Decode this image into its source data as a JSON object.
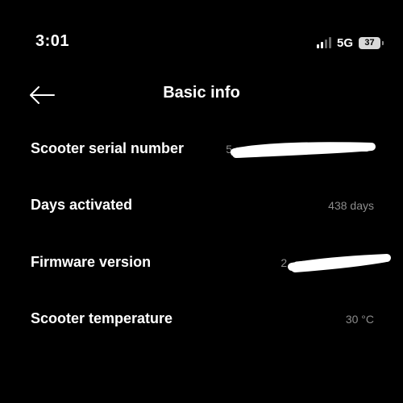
{
  "status_bar": {
    "time": "3:01",
    "network": "5G",
    "battery": "37"
  },
  "header": {
    "title": "Basic info",
    "back_icon": "arrow-left-icon"
  },
  "rows": [
    {
      "label": "Scooter serial number",
      "value": "5"
    },
    {
      "label": "Days activated",
      "value": "438 days"
    },
    {
      "label": "Firmware version",
      "value": "2."
    },
    {
      "label": "Scooter temperature",
      "value": "30 °C"
    }
  ],
  "colors": {
    "background": "#000000",
    "label": "#ffffff",
    "value": "#8c8c8c"
  }
}
